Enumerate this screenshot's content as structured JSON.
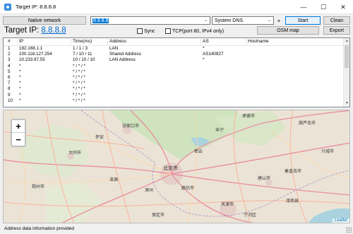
{
  "window": {
    "title": "Target IP: 8.8.8.8",
    "minimize_glyph": "—",
    "maximize_glyph": "☐",
    "close_glyph": "✕"
  },
  "toolbar": {
    "network_button": "Native network",
    "target_input": "8.8.8.8",
    "dns_select": "System DNS",
    "plus_button": "+",
    "start_button": "Start",
    "clean_button": "Clean",
    "osm_button": "OSM map",
    "export_button": "Export"
  },
  "target": {
    "label": "Target IP:",
    "ip": "8.8.8.8"
  },
  "options": {
    "sync_label": "Sync",
    "tcp_label": "TCP(port 80, IPv4 only)"
  },
  "table": {
    "headers": [
      "#",
      "IP",
      "Time(ms)",
      "Address",
      "AS",
      "Hostname"
    ],
    "rows": [
      [
        "1",
        "192.168.1.1",
        "1 / 1 / 3",
        "LAN",
        "*",
        ""
      ],
      [
        "2",
        "100.118.127.254",
        "7 / 10 / 11",
        "Shared Address",
        "AS140927",
        ""
      ],
      [
        "3",
        "10.233.97.55",
        "10 / 10 / 10",
        "LAN Address",
        "*",
        ""
      ],
      [
        "4",
        "*",
        "* / * / *",
        "",
        "",
        ""
      ],
      [
        "5",
        "*",
        "* / * / *",
        "",
        "",
        ""
      ],
      [
        "6",
        "*",
        "* / * / *",
        "",
        "",
        ""
      ],
      [
        "7",
        "*",
        "* / * / *",
        "",
        "",
        ""
      ],
      [
        "8",
        "*",
        "* / * / *",
        "",
        "",
        ""
      ],
      [
        "9",
        "*",
        "* / * / *",
        "",
        "",
        ""
      ],
      [
        "10",
        "*",
        "* / * / *",
        "",
        "",
        ""
      ]
    ]
  },
  "map": {
    "zoom_in": "+",
    "zoom_out": "−",
    "attribution": "Leaflet"
  },
  "status": {
    "text": "Address data information provided"
  }
}
